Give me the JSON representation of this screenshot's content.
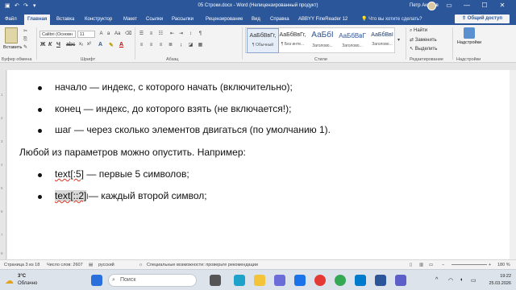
{
  "titlebar": {
    "title": "05 Строки.docx  -  Word (Нелицензированный продукт)",
    "user": "Петр Акимов",
    "minimize": "—",
    "maximize": "☐",
    "close": "✕"
  },
  "tabs": [
    "Файл",
    "Главная",
    "Вставка",
    "Конструктор",
    "Макет",
    "Ссылки",
    "Рассылки",
    "Рецензирование",
    "Вид",
    "Справка",
    "ABBYY FineReader 12"
  ],
  "active_tab": "Главная",
  "tell_me": "Что вы хотите сделать?",
  "share": "Общий доступ",
  "ribbon": {
    "paste": "Вставить",
    "clipboard_group": "Буфер обмена",
    "font_name": "Calibri (Основн",
    "font_size": "11",
    "font_group": "Шрифт",
    "paragraph_group": "Абзац",
    "styles_group": "Стили",
    "editing_group": "Редактирование",
    "addins_group": "Надстройки",
    "addins_button": "Надстройки",
    "find": "Найти",
    "replace": "Заменить",
    "select": "Выделить",
    "styles": [
      {
        "sample": "АаБбВвГг,",
        "name": "¶ Обычный"
      },
      {
        "sample": "АаБбВвГг,",
        "name": "¶ Без инте..."
      },
      {
        "sample": "АаБбI",
        "name": "Заголово..."
      },
      {
        "sample": "АаБбВвГ",
        "name": "Заголово..."
      },
      {
        "sample": "АаБбВвІ",
        "name": "Заголово..."
      }
    ]
  },
  "doc": {
    "b1": "начало — индекс, с которого начать (включительно);",
    "b2": "конец — индекс, до которого взять (не включается!);",
    "b3": "шаг — через сколько элементов двигаться (по умолчанию 1).",
    "para": "Любой из параметров можно опустить. Например:",
    "b4_code": "text[:5]",
    "b4_rest": " — первые 5 символов;",
    "b5_code": "text[::2]",
    "b5_rest": "— каждый второй символ;"
  },
  "ruler_numbers": [
    "1",
    "2",
    "3",
    "4",
    "5",
    "6",
    "7",
    "8"
  ],
  "status": {
    "page": "Страница 3 из 18",
    "words": "Число слов: 2607",
    "lang": "русский",
    "accessibility": "Специальные возможности: проверьте рекомендации",
    "zoom": "180 %"
  },
  "taskbar": {
    "temp": "3°C",
    "weather": "Облачно",
    "search": "Поиск",
    "time": "19:22",
    "date": "25.03.2026",
    "icons": [
      "windows-start",
      "search",
      "task-view",
      "edge",
      "explorer",
      "store",
      "mail",
      "yandex",
      "chrome",
      "vscode",
      "word",
      "teams"
    ]
  }
}
